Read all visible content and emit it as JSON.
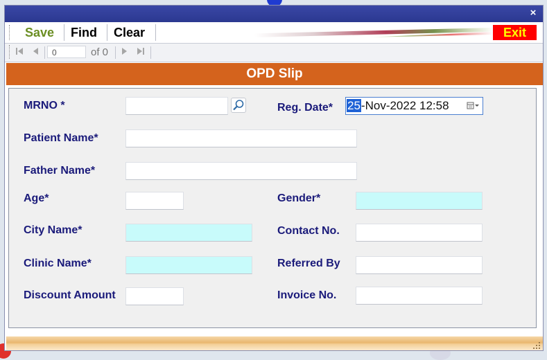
{
  "window": {
    "close_label": "×"
  },
  "toolbar": {
    "save_label": "Save",
    "find_label": "Find",
    "clear_label": "Clear",
    "exit_label": "Exit",
    "colors": {
      "save": "#6b8e23",
      "exit_bg": "#ff0000",
      "exit_text": "#ffff00"
    }
  },
  "navigator": {
    "position": "0",
    "total_label": "of 0",
    "icons": [
      "first-record-icon",
      "previous-record-icon",
      "next-record-icon",
      "last-record-icon"
    ]
  },
  "form": {
    "title": "OPD Slip",
    "header_color": "#d4631d",
    "label_color": "#1a1a7a",
    "fields": {
      "mrno": {
        "label": "MRNO *",
        "value": ""
      },
      "reg_date": {
        "label": "Reg. Date*",
        "day": "25",
        "rest": "-Nov-2022 12:58"
      },
      "patient_name": {
        "label": "Patient Name*",
        "value": ""
      },
      "father_name": {
        "label": "Father Name*",
        "value": ""
      },
      "age": {
        "label": "Age*",
        "value": ""
      },
      "gender": {
        "label": "Gender*",
        "value": ""
      },
      "city_name": {
        "label": "City Name*",
        "value": ""
      },
      "contact_no": {
        "label": "Contact No.",
        "value": ""
      },
      "clinic_name": {
        "label": "Clinic Name*",
        "value": ""
      },
      "referred_by": {
        "label": "Referred By",
        "value": ""
      },
      "discount_amount": {
        "label": "Discount Amount",
        "value": ""
      },
      "invoice_no": {
        "label": "Invoice No.",
        "value": ""
      }
    },
    "lookup_field_color": "#c8fbfb"
  }
}
